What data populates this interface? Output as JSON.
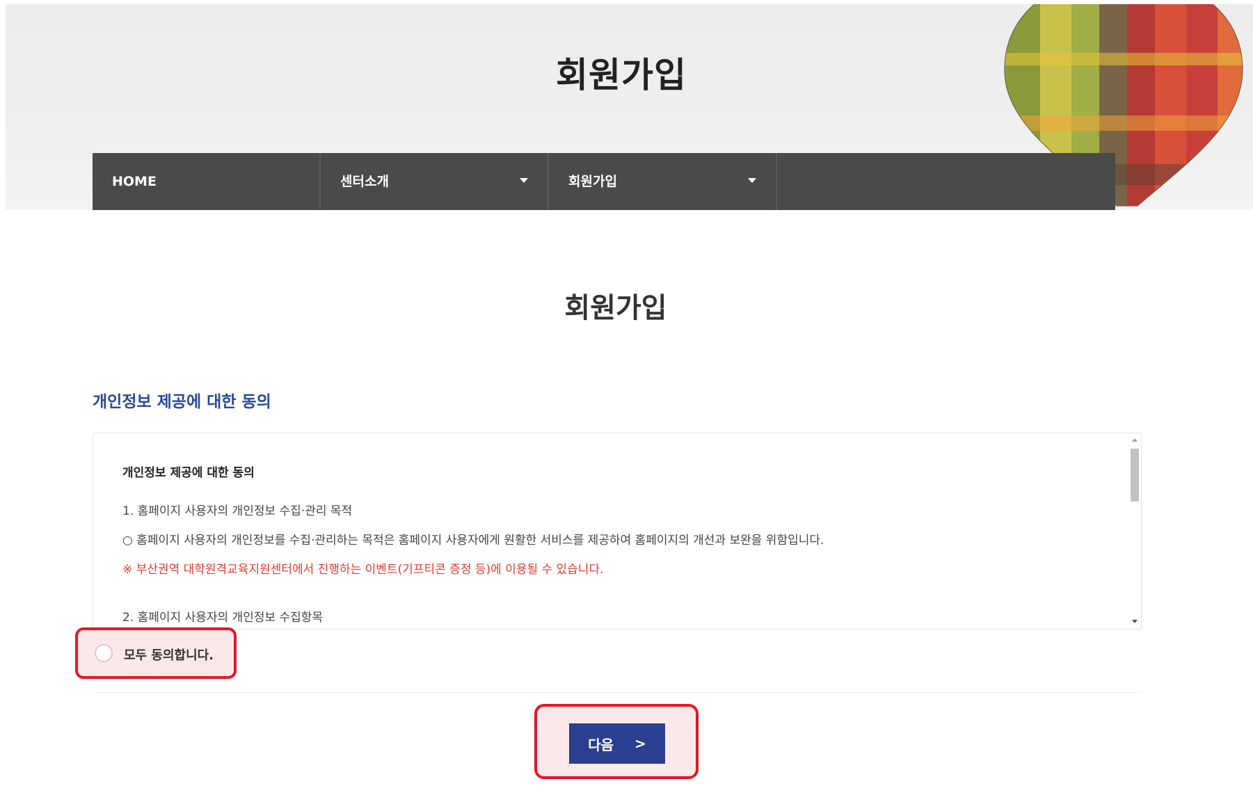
{
  "header": {
    "title": "회원가입"
  },
  "nav": {
    "items": [
      {
        "label": "HOME"
      },
      {
        "label": "센터소개"
      },
      {
        "label": "회원가입"
      }
    ]
  },
  "main": {
    "title": "회원가입",
    "section_title": "개인정보 제공에 대한 동의"
  },
  "terms": {
    "heading": "개인정보 제공에 대한 동의",
    "line1": "1. 홈페이지 사용자의 개인정보 수집·관리 목적",
    "line2": "○ 홈페이지 사용자의 개인정보를 수집·관리하는 목적은 홈페이지 사용자에게 원활한 서비스를 제공하여 홈페이지의 개선과 보완을 위함입니다.",
    "line3": "※ 부산권역 대학원격교육지원센터에서 진행하는 이벤트(기프티콘 증정 등)에 이용될 수 있습니다.",
    "line4": "2. 홈페이지 사용자의 개인정보 수집항목"
  },
  "agree": {
    "label": "모두 동의합니다."
  },
  "next_button": {
    "label": "다음",
    "arrow": ">"
  },
  "colors": {
    "nav_bg": "#4a4a4a",
    "section_title": "#274a9a",
    "highlight_border": "#e8152a",
    "highlight_fill": "#fbe9ea",
    "button_bg": "#2a3f8f",
    "notice_red": "#e63a2e"
  }
}
